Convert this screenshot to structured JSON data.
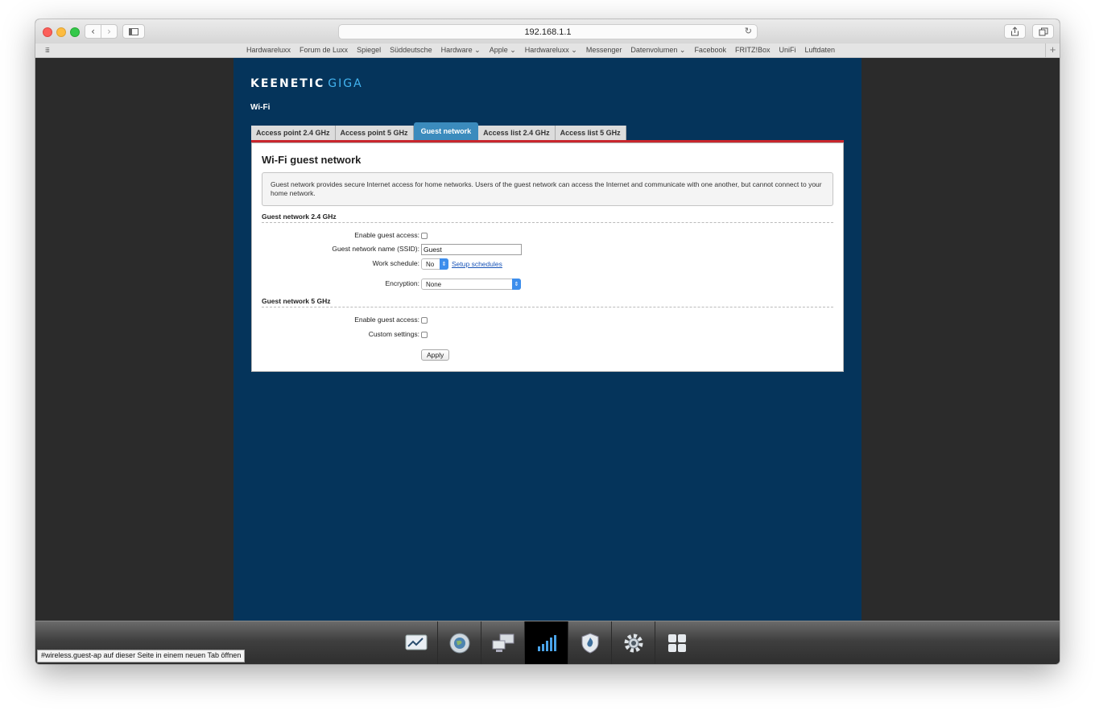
{
  "browser": {
    "url": "192.168.1.1",
    "favorites": [
      "Hardwareluxx",
      "Forum de Luxx",
      "Spiegel",
      "Süddeutsche",
      "Hardware ⌄",
      "Apple ⌄",
      "Hardwareluxx ⌄",
      "Messenger",
      "Datenvolumen ⌄",
      "Facebook",
      "FRITZ!Box",
      "UniFi",
      "Luftdaten"
    ],
    "status_text": "#wireless.guest-ap auf dieser Seite in einem neuen Tab öffnen"
  },
  "router": {
    "brand": "KEENETIC",
    "model": "GIGA",
    "page_title": "Wi-Fi",
    "tabs": [
      {
        "label": "Access point 2.4 GHz",
        "active": false
      },
      {
        "label": "Access point 5 GHz",
        "active": false
      },
      {
        "label": "Guest network",
        "active": true
      },
      {
        "label": "Access list 2.4 GHz",
        "active": false
      },
      {
        "label": "Access list 5 GHz",
        "active": false
      }
    ],
    "panel": {
      "title": "Wi-Fi guest network",
      "info": "Guest network provides secure Internet access for home networks. Users of the guest network can access the Internet and communicate with one another, but cannot connect to your home network.",
      "section_24": {
        "heading": "Guest network 2.4 GHz",
        "enable_label": "Enable guest access:",
        "ssid_label": "Guest network name (SSID):",
        "ssid_value": "Guest",
        "schedule_label": "Work schedule:",
        "schedule_value": "No",
        "schedule_link": "Setup schedules",
        "encryption_label": "Encryption:",
        "encryption_value": "None"
      },
      "section_5": {
        "heading": "Guest network 5 GHz",
        "enable_label": "Enable guest access:",
        "custom_label": "Custom settings:"
      },
      "apply_label": "Apply"
    },
    "dock": [
      "monitor-icon",
      "internet-globe-icon",
      "home-network-icon",
      "wifi-signal-icon",
      "security-shield-icon",
      "settings-gear-icon",
      "apps-grid-icon"
    ],
    "active_dock": "wifi-signal-icon"
  }
}
